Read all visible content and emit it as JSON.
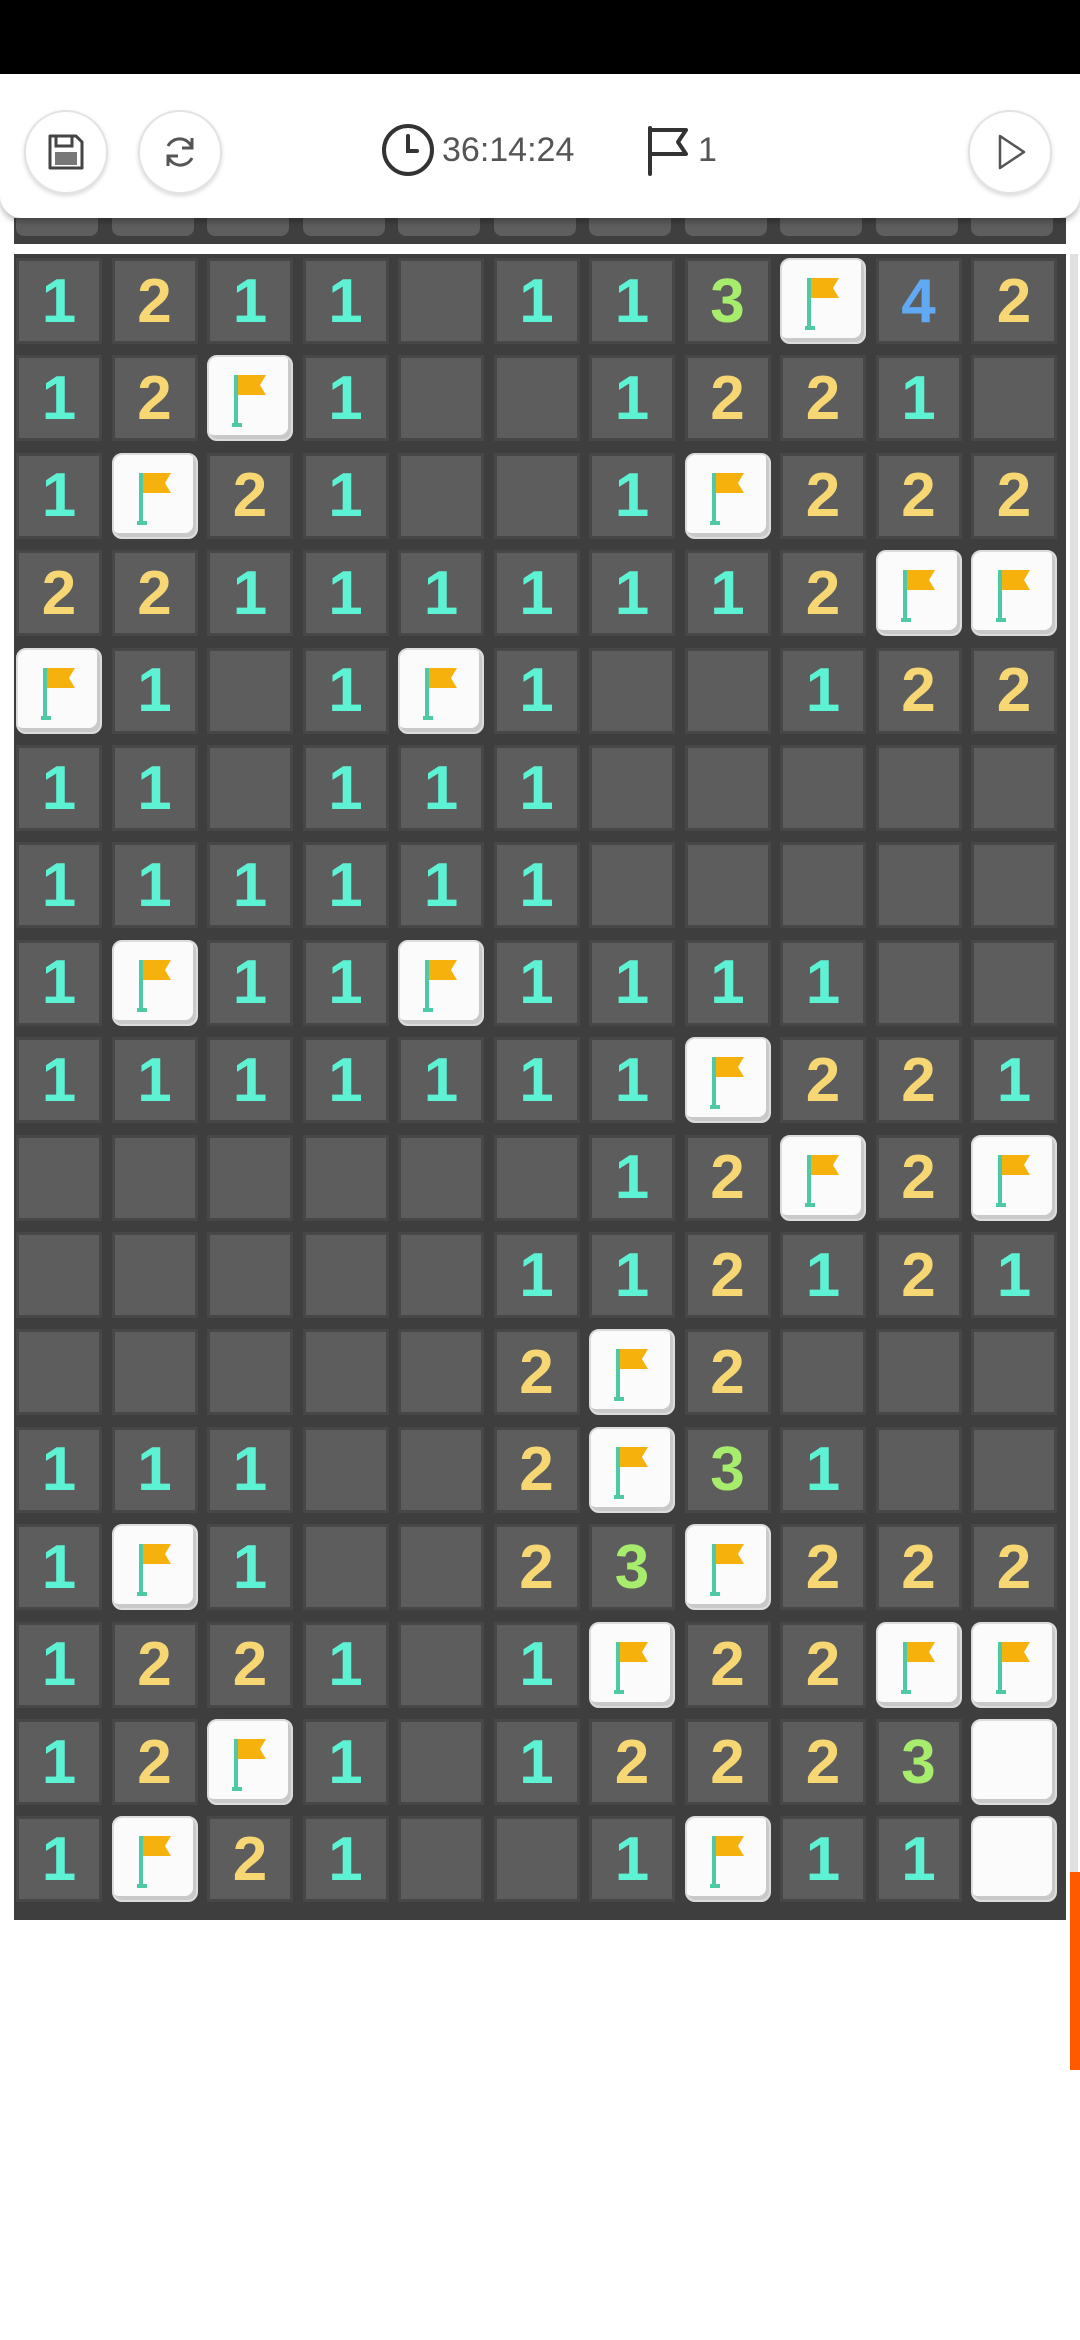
{
  "toolbar": {
    "timer": "36:14:24",
    "flag_count": "1",
    "icons": {
      "save": "floppy-disk-icon",
      "restart": "refresh-icon",
      "clock": "clock-icon",
      "flag": "flag-outline-icon",
      "play": "play-triangle-icon"
    }
  },
  "colors": {
    "one": "#5ef2d4",
    "two": "#f7d774",
    "three": "#a8ec6e",
    "four": "#62a9f4",
    "flag": "#f6b10c",
    "pole": "#4ec9a6",
    "accent": "#ff5a00"
  },
  "board": {
    "columns": 11,
    "rows": [
      [
        "1",
        "2",
        "1",
        "1",
        "",
        "1",
        "1",
        "3",
        "F",
        "4",
        "2"
      ],
      [
        "1",
        "2",
        "F",
        "1",
        "",
        "",
        "1",
        "2",
        "2",
        "1",
        ""
      ],
      [
        "1",
        "F",
        "2",
        "1",
        "",
        "",
        "1",
        "F",
        "2",
        "2",
        "2"
      ],
      [
        "2",
        "2",
        "1",
        "1",
        "1",
        "1",
        "1",
        "1",
        "2",
        "F",
        "F"
      ],
      [
        "F",
        "1",
        "",
        "1",
        "F",
        "1",
        "",
        "",
        "1",
        "2",
        "2"
      ],
      [
        "1",
        "1",
        "",
        "1",
        "1",
        "1",
        "",
        "",
        "",
        "",
        ""
      ],
      [
        "1",
        "1",
        "1",
        "1",
        "1",
        "1",
        "",
        "",
        "",
        "",
        ""
      ],
      [
        "1",
        "F",
        "1",
        "1",
        "F",
        "1",
        "1",
        "1",
        "1",
        "",
        ""
      ],
      [
        "1",
        "1",
        "1",
        "1",
        "1",
        "1",
        "1",
        "F",
        "2",
        "2",
        "1"
      ],
      [
        "",
        "",
        "",
        "",
        "",
        "",
        "1",
        "2",
        "F",
        "2",
        "F"
      ],
      [
        "",
        "",
        "",
        "",
        "",
        "1",
        "1",
        "2",
        "1",
        "2",
        "1"
      ],
      [
        "",
        "",
        "",
        "",
        "",
        "2",
        "F",
        "2",
        "",
        "",
        ""
      ],
      [
        "1",
        "1",
        "1",
        "",
        "",
        "2",
        "F",
        "3",
        "1",
        "",
        ""
      ],
      [
        "1",
        "F",
        "1",
        "",
        "",
        "2",
        "3",
        "F",
        "2",
        "2",
        "2"
      ],
      [
        "1",
        "2",
        "2",
        "1",
        "",
        "1",
        "F",
        "2",
        "2",
        "F",
        "F"
      ],
      [
        "1",
        "2",
        "F",
        "1",
        "",
        "1",
        "2",
        "2",
        "2",
        "3",
        "U"
      ],
      [
        "1",
        "F",
        "2",
        "1",
        "",
        "",
        "1",
        "F",
        "1",
        "1",
        "U"
      ]
    ]
  }
}
